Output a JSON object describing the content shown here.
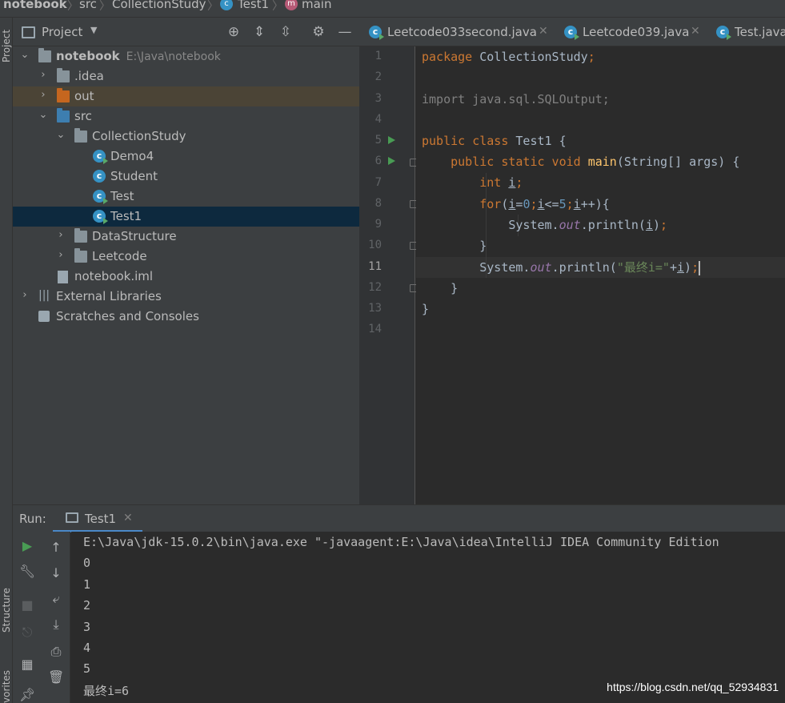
{
  "breadcrumb": {
    "project": "notebook",
    "src": "src",
    "package": "CollectionStudy",
    "class": "Test1",
    "method": "main"
  },
  "left_stripe": {
    "project_tab": "Project",
    "structure_tab": "Structure",
    "favorites_tab": "vorites"
  },
  "project_panel": {
    "title": "Project",
    "tree": [
      {
        "label": "notebook",
        "path": "E:\\Java\\notebook"
      },
      {
        "label": ".idea"
      },
      {
        "label": "out"
      },
      {
        "label": "src"
      },
      {
        "label": "CollectionStudy"
      },
      {
        "label": "Demo4"
      },
      {
        "label": "Student"
      },
      {
        "label": "Test"
      },
      {
        "label": "Test1"
      },
      {
        "label": "DataStructure"
      },
      {
        "label": "Leetcode"
      },
      {
        "label": "notebook.iml"
      },
      {
        "label": "External Libraries"
      },
      {
        "label": "Scratches and Consoles"
      }
    ]
  },
  "editor_tabs": [
    {
      "label": "Leetcode033second.java"
    },
    {
      "label": "Leetcode039.java"
    },
    {
      "label": "Test.java"
    }
  ],
  "editor": {
    "line_numbers": [
      "1",
      "2",
      "3",
      "4",
      "5",
      "6",
      "7",
      "8",
      "9",
      "10",
      "11",
      "12",
      "13",
      "14"
    ],
    "current_line": "11",
    "code": {
      "l1_kw": "package",
      "l1_rest": " CollectionStudy",
      "l1_semi": ";",
      "l3": "import java.sql.SQLOutput;",
      "l5_kw": "public class",
      "l5_rest": " Test1 {",
      "l6_kw": "public static void",
      "l6_fn": "main",
      "l6_rest": "(String[] args) {",
      "l7_kw": "int",
      "l7_var": "i",
      "l7_semi": ";",
      "l8_kw": "for",
      "l8_p1": "(",
      "l8_i1": "i",
      "l8_eq": "=",
      "l8_n0": "0",
      "l8_s1": ";",
      "l8_i2": "i",
      "l8_le": "<=",
      "l8_n5": "5",
      "l8_s2": ";",
      "l8_i3": "i",
      "l8_end": "++){",
      "l9_a": "System.",
      "l9_out": "out",
      "l9_b": ".println(",
      "l9_i": "i",
      "l9_c": ")",
      "l9_semi": ";",
      "l10": "}",
      "l11_a": "System.",
      "l11_out": "out",
      "l11_b": ".println(",
      "l11_str": "\"最终i=\"",
      "l11_plus": "+",
      "l11_i": "i",
      "l11_c": ")",
      "l11_semi": ";",
      "l12": "}",
      "l13": "}"
    }
  },
  "run_panel": {
    "label": "Run:",
    "tab": "Test1",
    "console": [
      "E:\\Java\\jdk-15.0.2\\bin\\java.exe \"-javaagent:E:\\Java\\idea\\IntelliJ IDEA Community Edition",
      "0",
      "1",
      "2",
      "3",
      "4",
      "5",
      "最终i=6"
    ]
  },
  "watermark": "https://blog.csdn.net/qq_52934831",
  "colors": {
    "keyword": "#cc7832",
    "string": "#6a8759",
    "number": "#6897bb",
    "field": "#9876aa",
    "method": "#ffc66d",
    "selection": "#0d293e",
    "accent": "#4a88c7"
  }
}
